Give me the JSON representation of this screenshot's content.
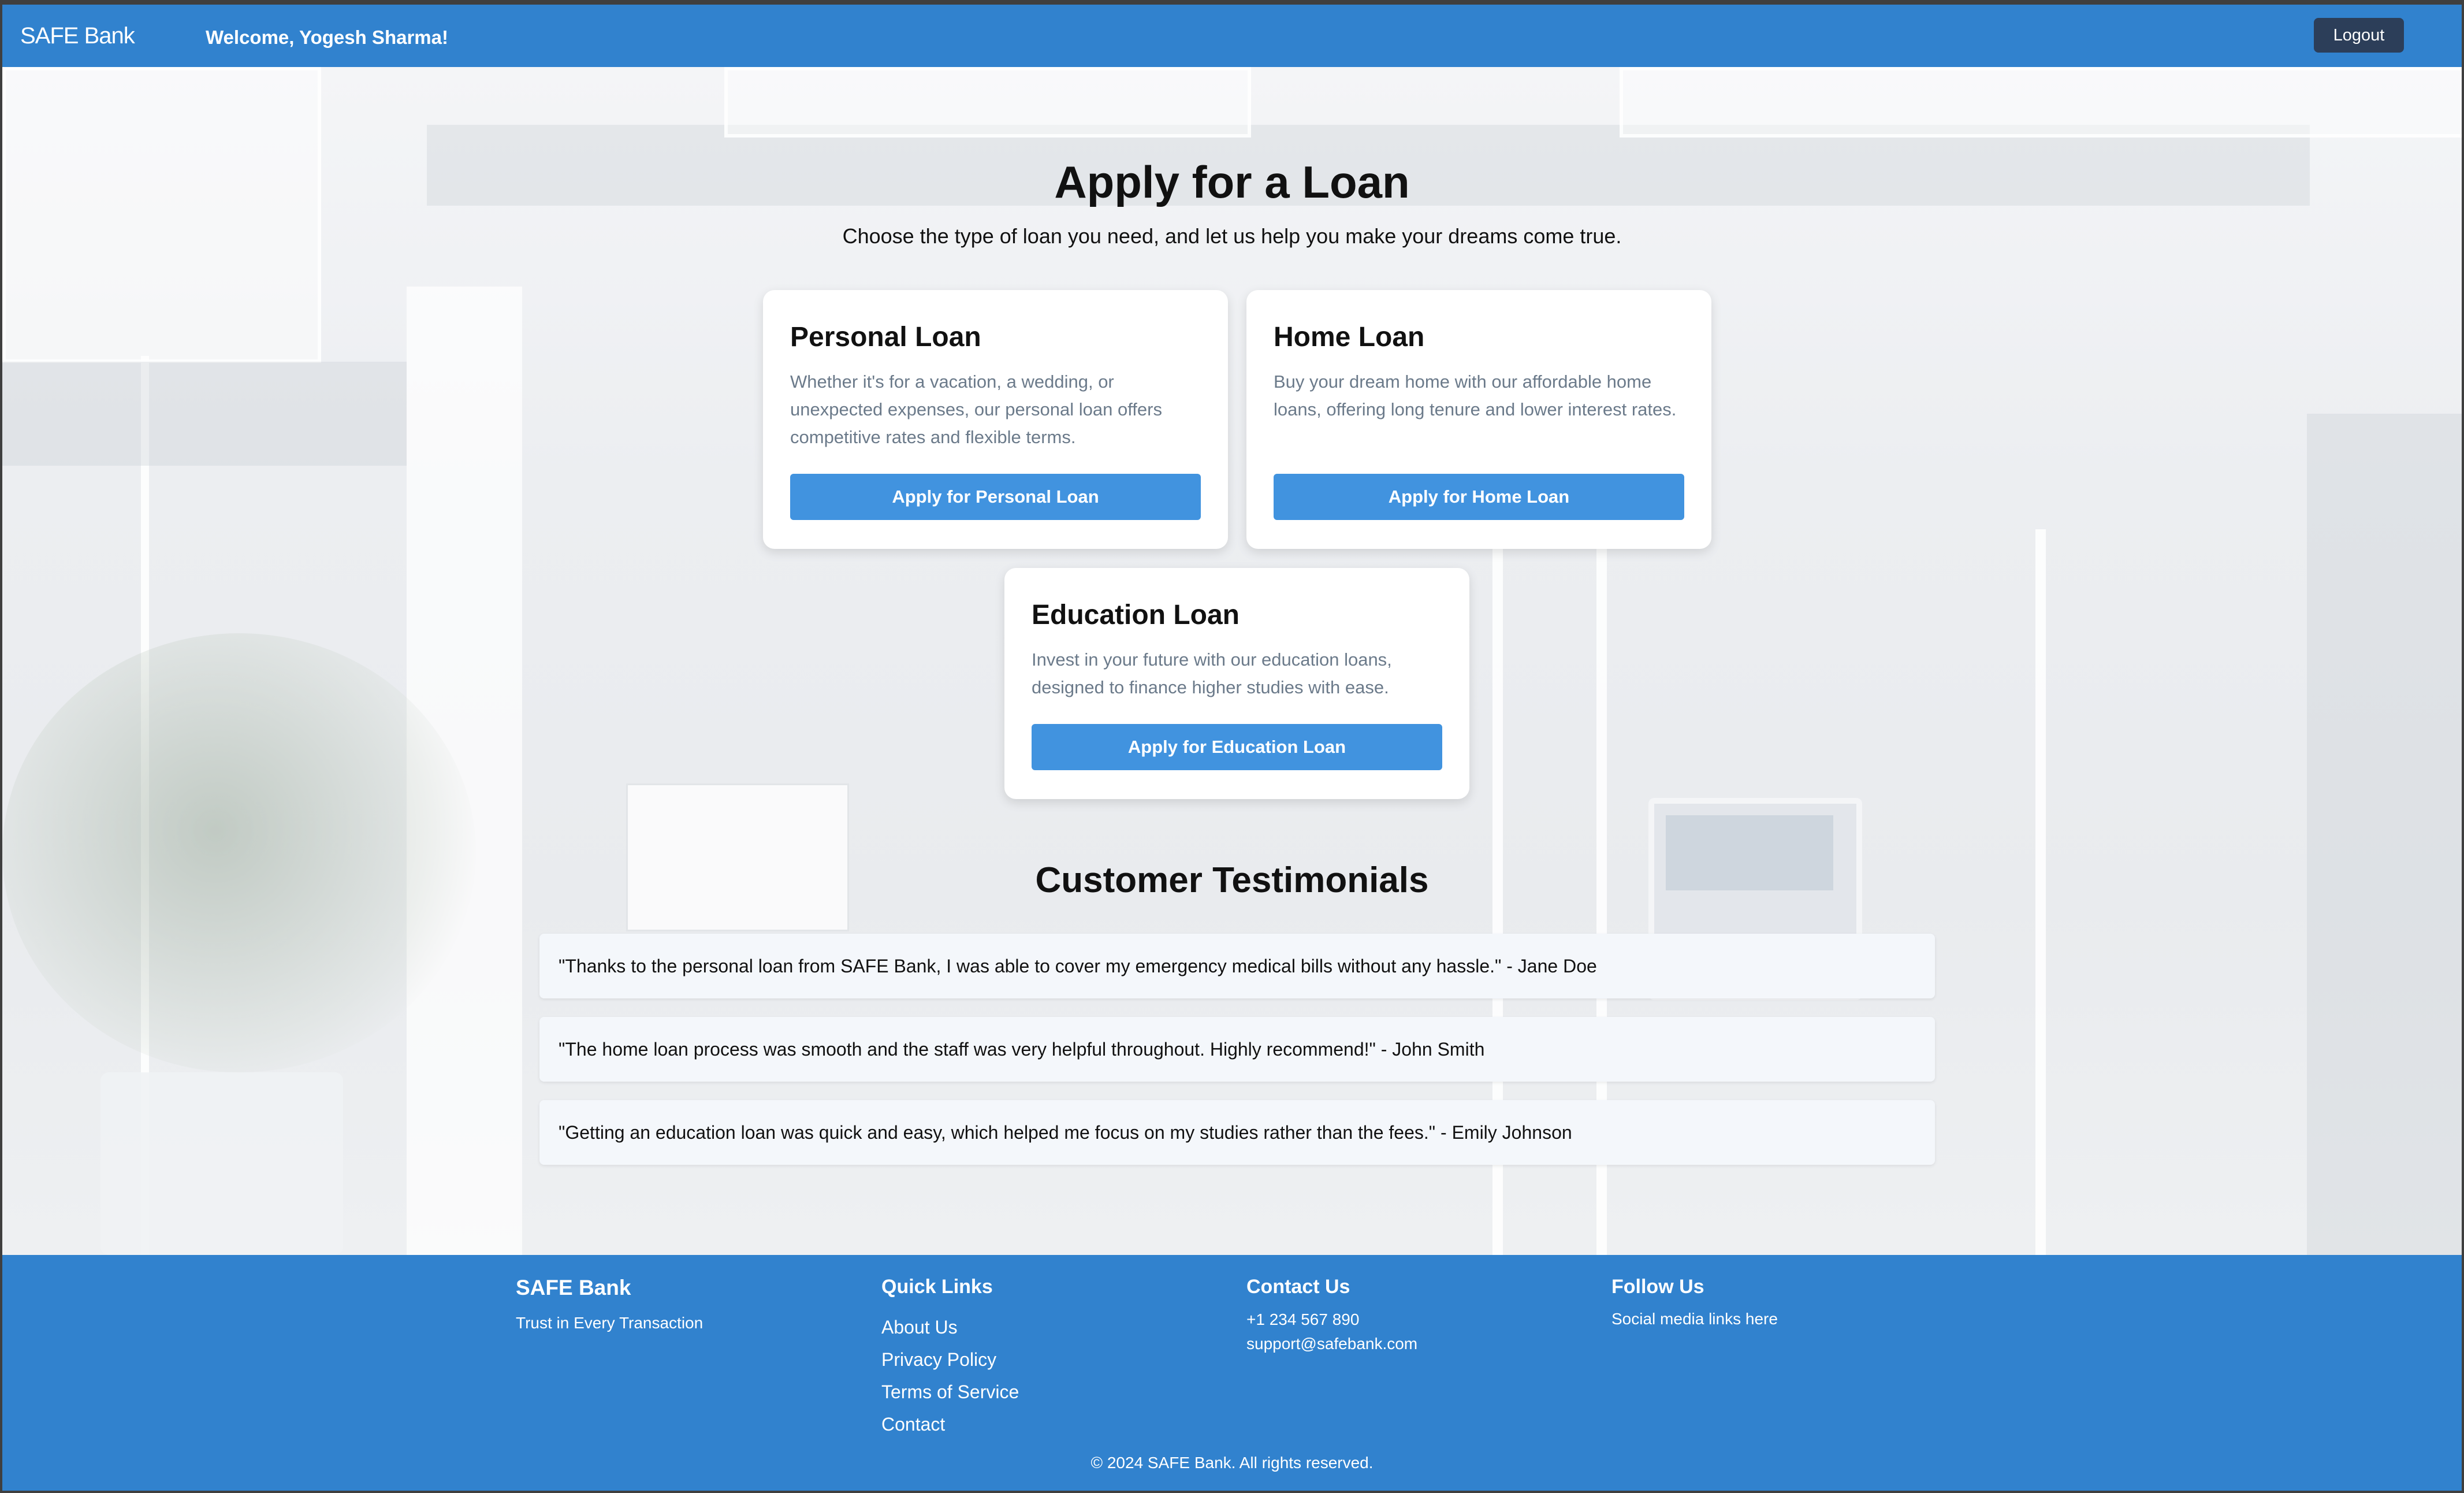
{
  "header": {
    "brand": "SAFE Bank",
    "welcome": "Welcome, Yogesh Sharma!",
    "logout_label": "Logout"
  },
  "main": {
    "title": "Apply for a Loan",
    "subtitle": "Choose the type of loan you need, and let us help you make your dreams come true.",
    "loans": [
      {
        "title": "Personal Loan",
        "description": "Whether it's for a vacation, a wedding, or unexpected expenses, our personal loan offers competitive rates and flexible terms.",
        "button": "Apply for Personal Loan"
      },
      {
        "title": "Home Loan",
        "description": "Buy your dream home with our affordable home loans, offering long tenure and lower interest rates.",
        "button": "Apply for Home Loan"
      },
      {
        "title": "Education Loan",
        "description": "Invest in your future with our education loans, designed to finance higher studies with ease.",
        "button": "Apply for Education Loan"
      }
    ]
  },
  "testimonials": {
    "title": "Customer Testimonials",
    "items": [
      "\"Thanks to the personal loan from SAFE Bank, I was able to cover my emergency medical bills without any hassle.\" - Jane Doe",
      "\"The home loan process was smooth and the staff was very helpful throughout. Highly recommend!\" - John Smith",
      "\"Getting an education loan was quick and easy, which helped me focus on my studies rather than the fees.\" - Emily Johnson"
    ]
  },
  "footer": {
    "brand": "SAFE Bank",
    "tagline": "Trust in Every Transaction",
    "quick_links_title": "Quick Links",
    "quick_links": [
      "About Us",
      "Privacy Policy",
      "Terms of Service",
      "Contact"
    ],
    "contact_title": "Contact Us",
    "phone": "+1 234 567 890",
    "email": "support@safebank.com",
    "follow_title": "Follow Us",
    "follow_text": "Social media links here",
    "copyright": "© 2024 SAFE Bank. All rights reserved."
  },
  "colors": {
    "primary": "#3182ce",
    "button": "#4193df",
    "logout_bg": "#2c3e59",
    "card_text": "#6b7a8a"
  }
}
